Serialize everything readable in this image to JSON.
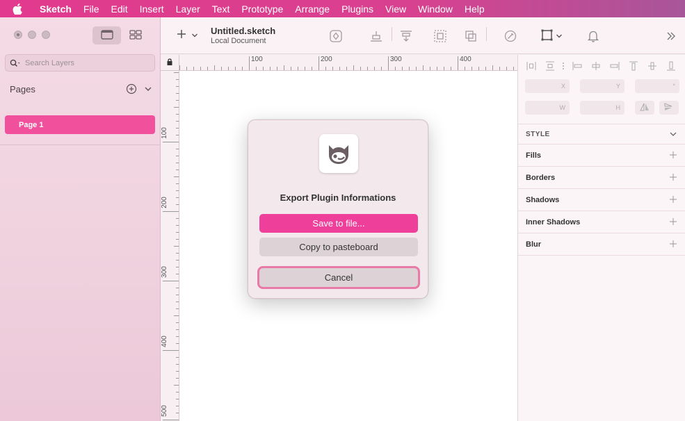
{
  "menubar": {
    "items": [
      "Sketch",
      "File",
      "Edit",
      "Insert",
      "Layer",
      "Text",
      "Prototype",
      "Arrange",
      "Plugins",
      "View",
      "Window",
      "Help"
    ]
  },
  "sidebar": {
    "search_placeholder": "Search Layers",
    "pages_title": "Pages",
    "pages": [
      "Page 1"
    ]
  },
  "toolbar": {
    "doc_name": "Untitled.sketch",
    "doc_location": "Local Document"
  },
  "rulers": {
    "horizontal": [
      "100",
      "200",
      "300",
      "400"
    ],
    "vertical": [
      "100",
      "200",
      "300",
      "400",
      "500"
    ]
  },
  "inspector": {
    "fields": {
      "x": "X",
      "y": "Y",
      "rotation": "°",
      "w": "W",
      "h": "H"
    },
    "style_header": "STYLE",
    "properties": [
      "Fills",
      "Borders",
      "Shadows",
      "Inner Shadows",
      "Blur"
    ]
  },
  "dialog": {
    "title": "Export Plugin Informations",
    "primary_button": "Save to file...",
    "secondary_button": "Copy to pasteboard",
    "cancel_button": "Cancel"
  },
  "colors": {
    "accent": "#ee3f9a",
    "menubar": "#e23a8e"
  }
}
